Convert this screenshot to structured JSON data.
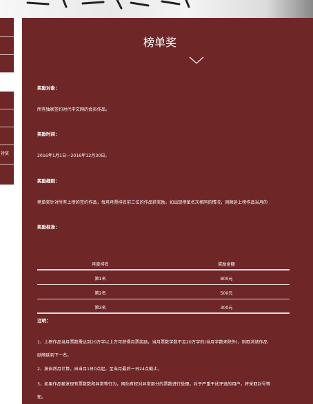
{
  "sidebar": {
    "items": [
      {
        "label": ""
      },
      {
        "label": ""
      },
      {
        "label": ""
      },
      {
        "label": ""
      },
      {
        "label": ""
      },
      {
        "label": ""
      },
      {
        "label": "持奖"
      },
      {
        "label": ""
      }
    ]
  },
  "main": {
    "title": "榜单奖",
    "sections": {
      "target": {
        "heading": "奖励对象：",
        "text": "所有独家签约时代中文网的会员作品。"
      },
      "time": {
        "heading": "奖励时间：",
        "text": "2016年1月1日—2016年12月30日。"
      },
      "rules": {
        "heading": "奖励细则：",
        "text": "榜单奖针对所有上榜的签约作品，每月月票排名前三位的作品获奖励。如出现榜单名次相同的情况，则顺延上榜作品当月的"
      },
      "standard": {
        "heading": "奖励标准："
      },
      "notes": {
        "heading": "注明：",
        "items": [
          "1、上榜作品当月票数需达到20万字以上方可获得月票奖励，当月票数字数不足20万字的(当月字数未除外)，则取消该作品",
          "励顺延到下一名。",
          "2、按自然月计算，自当月1日0点起，至当月最后一日24点截止。",
          "3、如果作品被发现有票数数和异常等行为，网站有权对异常部分的票数进行处理。对于严重干扰评选的用户，将采取封号等",
          "知。"
        ]
      }
    },
    "table": {
      "headers": [
        "月度排名",
        "奖励金额"
      ],
      "rows": [
        [
          "第1名",
          "800元"
        ],
        [
          "第2名",
          "500元"
        ],
        [
          "第3名",
          "300元"
        ]
      ]
    }
  }
}
